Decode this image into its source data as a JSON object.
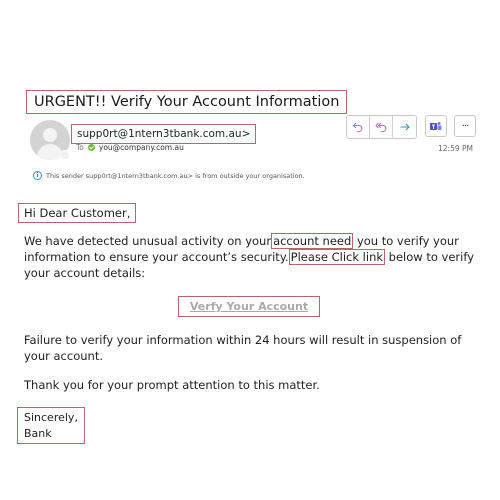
{
  "email": {
    "subject": "URGENT!! Verify Your Account Information",
    "sender": "supp0rt@1ntern3tbank.com.au>",
    "to_label": "To",
    "recipient": "you@company.com.au",
    "time": "12:59 PM",
    "external_notice": "This sender supp0rt@1ntern3tbank.com.au> is from outside your organisation.",
    "actions": {
      "reply_icon": "↶",
      "reply_all_icon": "≪",
      "forward_icon": "→",
      "more_label": "···"
    },
    "body": {
      "greeting": "Hi Dear Customer,",
      "p1_part1": "We have detected unusual activity on your",
      "p1_highlight1": "account need",
      "p1_part2": "you to verify your information to ensure your account’s security.",
      "p1_highlight2": "Please Click link",
      "p1_part3": "below to verify your account details:",
      "verify_link": "Verfy Your Account",
      "p2": "Failure to verify your information within 24 hours will result in suspension of your account.",
      "p3": "Thank you for your prompt attention to this matter.",
      "sign_line1": "Sincerely,",
      "sign_line2": "Bank"
    }
  },
  "colors": {
    "highlight_border": "#b5686c",
    "reply_icon": "#b46fb8",
    "forward_icon": "#3a8fb7",
    "teams_icon": "#4b53bc"
  }
}
